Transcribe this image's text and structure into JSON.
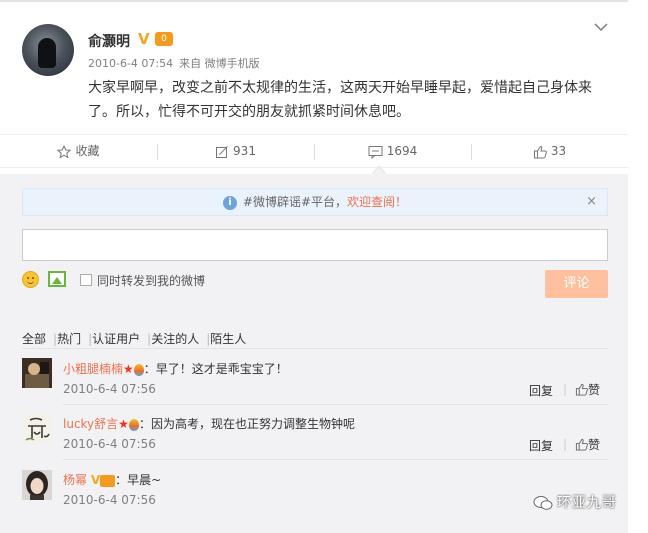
{
  "post": {
    "author": "俞灏明",
    "verified_mark": "V",
    "member_badge": "0",
    "time": "2010-6-4 07:54",
    "source": "来自 微博手机版",
    "text": "大家早啊早，改变之前不太规律的生活，这两天开始早睡早起，爱惜起自己身体来了。所以，忙得不可开交的朋友就抓紧时间休息吧。"
  },
  "actions": {
    "favorite": "收藏",
    "repost_count": "931",
    "comment_count": "1694",
    "like_count": "33"
  },
  "notice": {
    "prefix": "#微博辟谣#平台，",
    "link": "欢迎查阅！",
    "close": "×"
  },
  "composer": {
    "repost_label": "同时转发到我的微博",
    "submit_label": "评论"
  },
  "filters": [
    "全部",
    "热门",
    "认证用户",
    "关注的人",
    "陌生人"
  ],
  "comments": [
    {
      "name": "小粗腿楠楠",
      "text": "：早了！这才是乖宝宝了！",
      "time": "2010-6-4 07:56",
      "reply": "回复",
      "like": "赞"
    },
    {
      "name": "lucky舒言",
      "text": "：因为高考，现在也正努力调整生物钟呢",
      "time": "2010-6-4 07:56",
      "reply": "回复",
      "like": "赞"
    },
    {
      "name": "杨幂",
      "verified_mark": "V",
      "text": "：早晨~",
      "time": "2010-6-4 07:56"
    }
  ],
  "watermark": "环亚九哥",
  "colors": {
    "accent": "#eb7350",
    "verified": "#f6a623",
    "submit_bg": "#ffc09f",
    "comment_bg": "#f2f2f5",
    "notice_bg": "#eaf2fb"
  }
}
